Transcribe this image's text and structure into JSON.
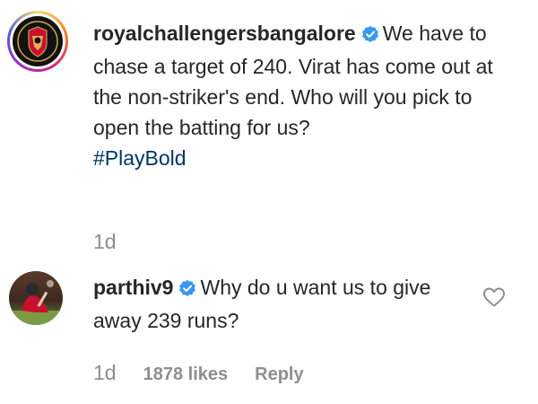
{
  "caption": {
    "username": "royalchallengersbangalore",
    "text": "We have to chase a target of 240. Virat has come out at the non-striker's end. Who will you pick to open the batting for us?",
    "hashtag": "#PlayBold",
    "time": "1d"
  },
  "reply": {
    "username": "parthiv9",
    "text": "Why do u want us to give away 239 runs?",
    "time": "1d",
    "likes": "1878 likes",
    "reply_label": "Reply"
  },
  "icons": {
    "verified": "verified-badge-icon",
    "like": "heart-outline-icon"
  },
  "colors": {
    "verified": "#3897f0",
    "muted": "#8e8e8e",
    "hashtag": "#003569"
  }
}
